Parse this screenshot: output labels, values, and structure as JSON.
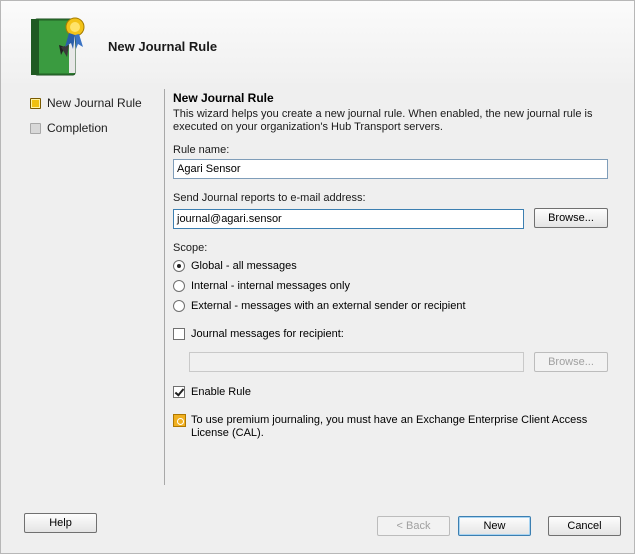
{
  "header": {
    "title": "New Journal Rule"
  },
  "nav": {
    "items": [
      {
        "label": "New Journal Rule",
        "state": "active"
      },
      {
        "label": "Completion",
        "state": "inactive"
      }
    ]
  },
  "content": {
    "section_title": "New Journal Rule",
    "description": "This wizard helps you create a new journal rule. When enabled, the new journal rule is executed on your organization's Hub Transport servers.",
    "rule_name_label": "Rule name:",
    "rule_name_value": "Agari Sensor",
    "send_to_label": "Send Journal reports to e-mail address:",
    "send_to_value": "journal@agari.sensor",
    "browse_label": "Browse...",
    "scope_label": "Scope:",
    "scope_options": [
      {
        "label": "Global - all messages",
        "checked": true
      },
      {
        "label": "Internal - internal messages only",
        "checked": false
      },
      {
        "label": "External - messages with an external sender or recipient",
        "checked": false
      }
    ],
    "recipient_check_label": "Journal messages for recipient:",
    "recipient_value": "",
    "recipient_browse_label": "Browse...",
    "enable_rule_label": "Enable Rule",
    "license_note": "To use premium journaling, you must have an Exchange Enterprise Client Access License (CAL)."
  },
  "footer": {
    "help_label": "Help",
    "back_label": "< Back",
    "new_label": "New",
    "cancel_label": "Cancel"
  },
  "colors": {
    "accent": "#3c7fb1",
    "active_bullet": "#f0c010"
  },
  "icons": {
    "header": "journal-book-icon",
    "note": "info-icon"
  }
}
